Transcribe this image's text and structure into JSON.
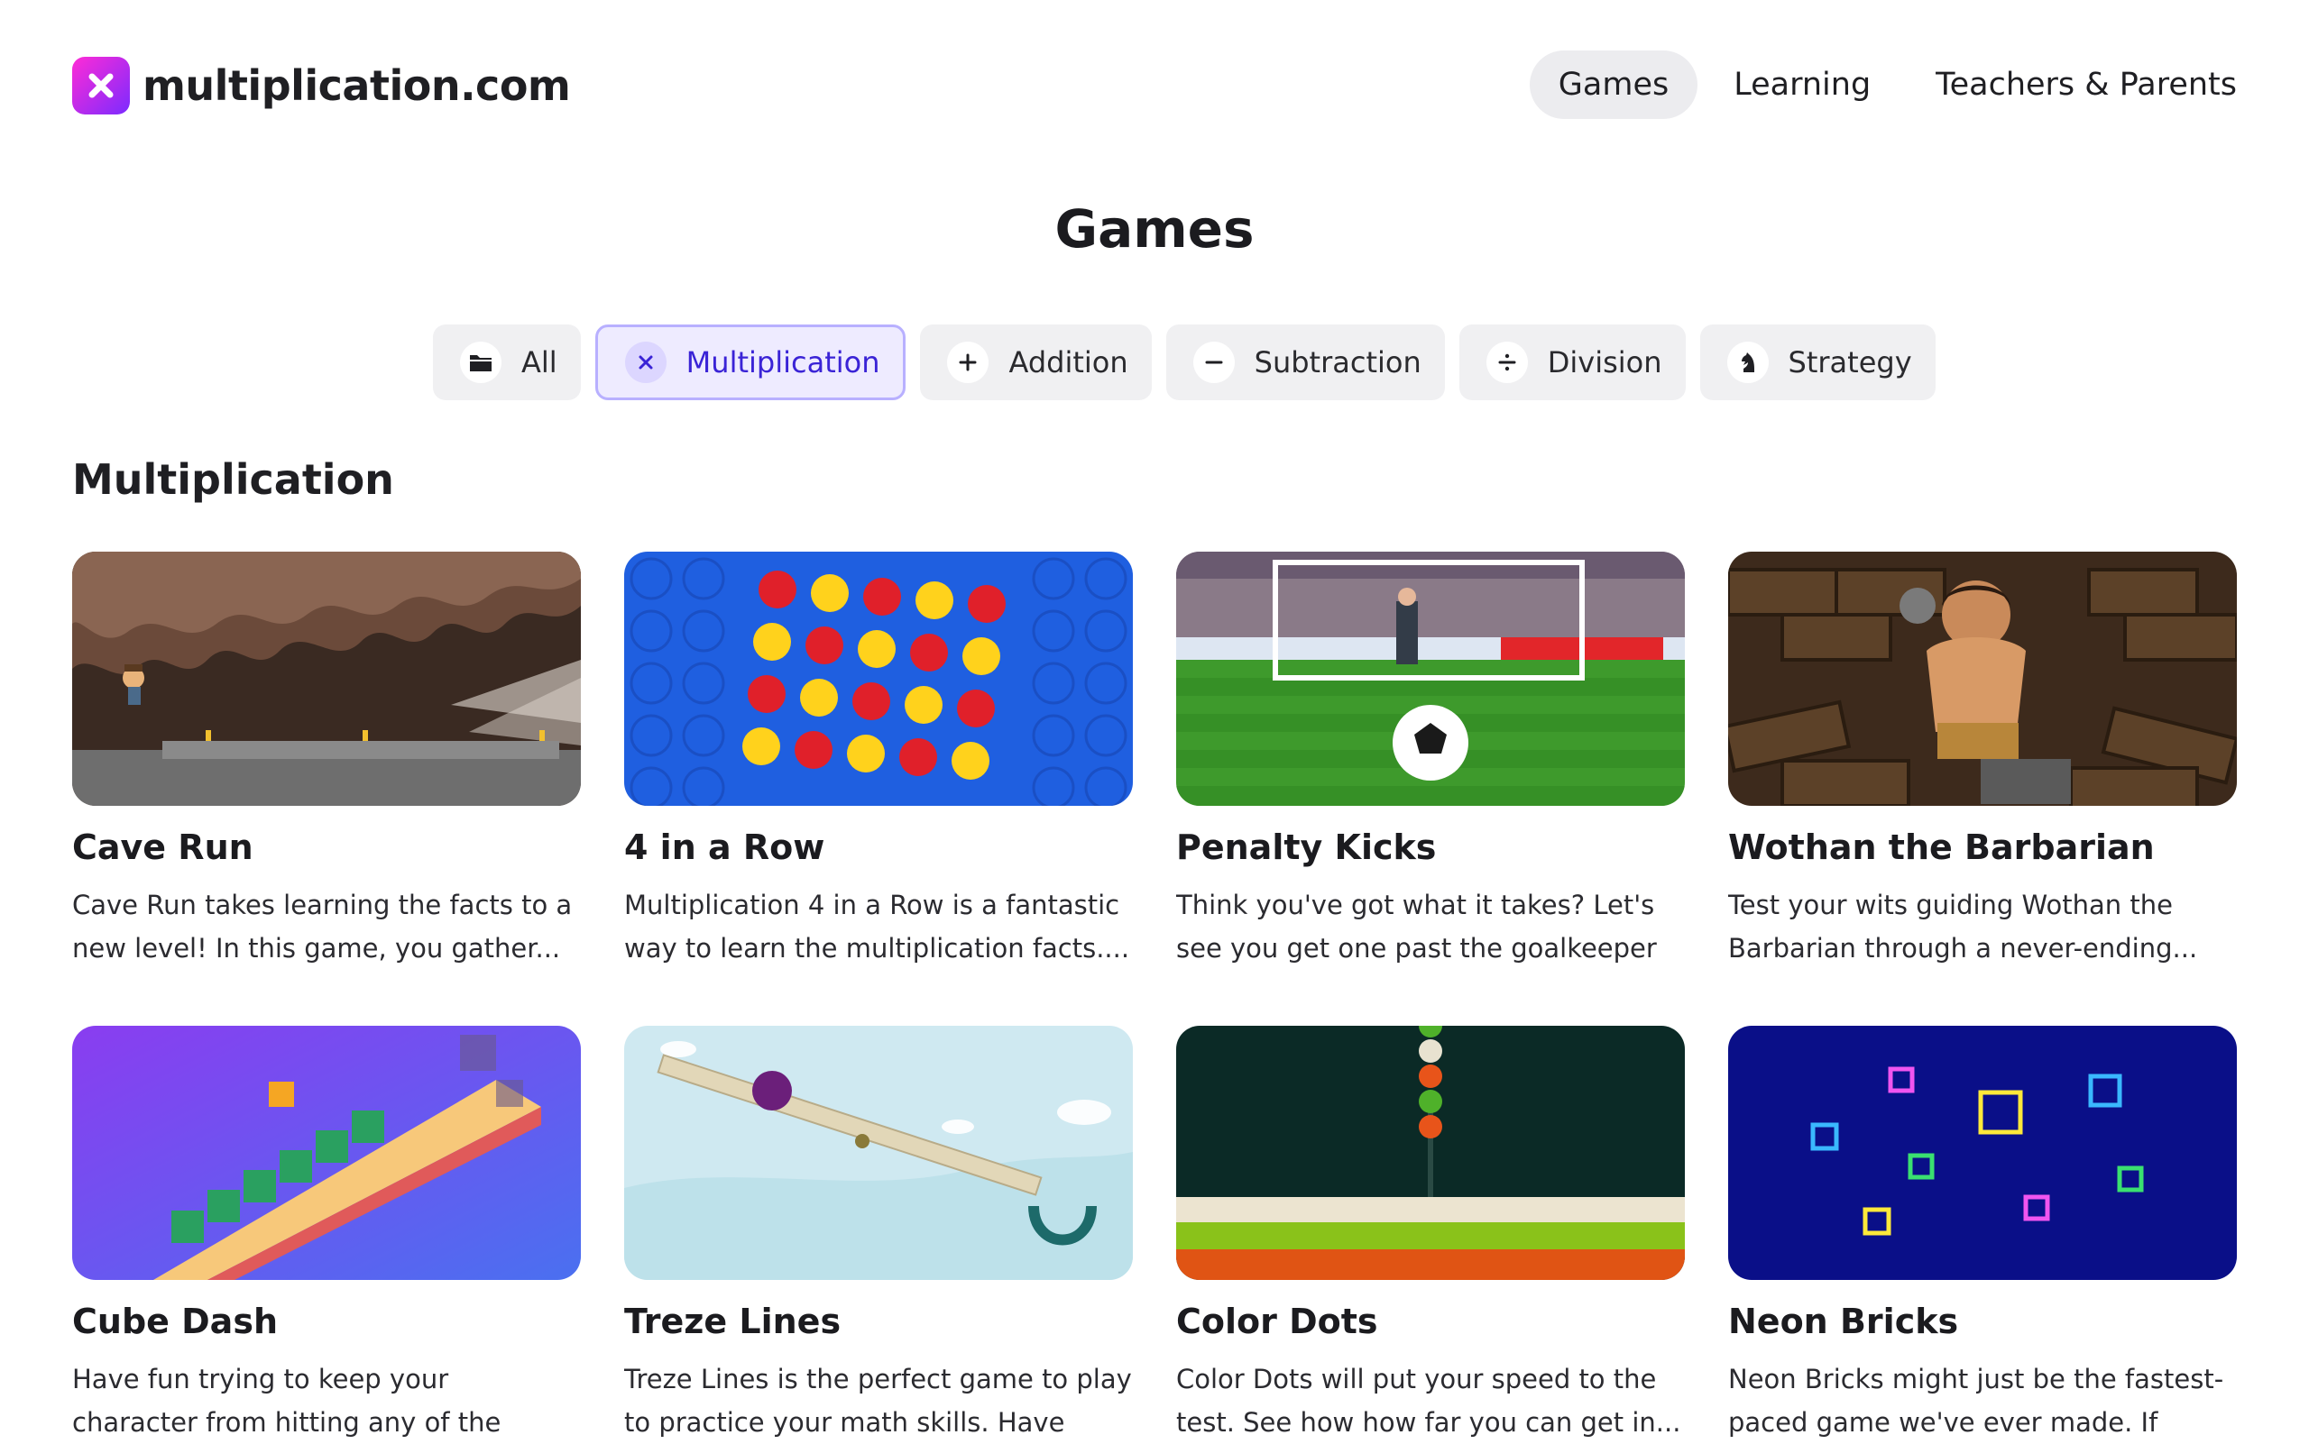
{
  "brand": {
    "name": "multiplication.com",
    "accent": "#7b2bff"
  },
  "nav": {
    "items": [
      "Games",
      "Learning",
      "Teachers & Parents"
    ],
    "active": "Games"
  },
  "page": {
    "title": "Games"
  },
  "filters": [
    {
      "label": "All",
      "icon": "folder-icon"
    },
    {
      "label": "Multiplication",
      "icon": "times-icon",
      "active": true
    },
    {
      "label": "Addition",
      "icon": "plus-icon"
    },
    {
      "label": "Subtraction",
      "icon": "minus-icon"
    },
    {
      "label": "Division",
      "icon": "divide-icon"
    },
    {
      "label": "Strategy",
      "icon": "chess-knight-icon"
    }
  ],
  "section": {
    "title": "Multiplication"
  },
  "games": [
    {
      "title": "Cave Run",
      "description": "Cave Run takes learning the facts to a new level! In this game, you gather..."
    },
    {
      "title": "4 in a Row",
      "description": "Multiplication 4 in a Row is a fantastic way to learn the multiplication facts...."
    },
    {
      "title": "Penalty Kicks",
      "description": "Think you've got what it takes? Let's see you get one past the goalkeeper i..."
    },
    {
      "title": "Wothan the Barbarian",
      "description": "Test your wits guiding Wothan the Barbarian through a never-ending..."
    },
    {
      "title": "Cube Dash",
      "description": "Have fun trying to keep your character from hitting any of the obstacles. You'..."
    },
    {
      "title": "Treze Lines",
      "description": "Treze Lines is the perfect game to play to practice your math skills. Have fun..."
    },
    {
      "title": "Color Dots",
      "description": "Color Dots will put your speed to the test. See how how far you can get in..."
    },
    {
      "title": "Neon Bricks",
      "description": "Neon Bricks might just be the fastest-paced game we've ever made. If you'r..."
    }
  ]
}
